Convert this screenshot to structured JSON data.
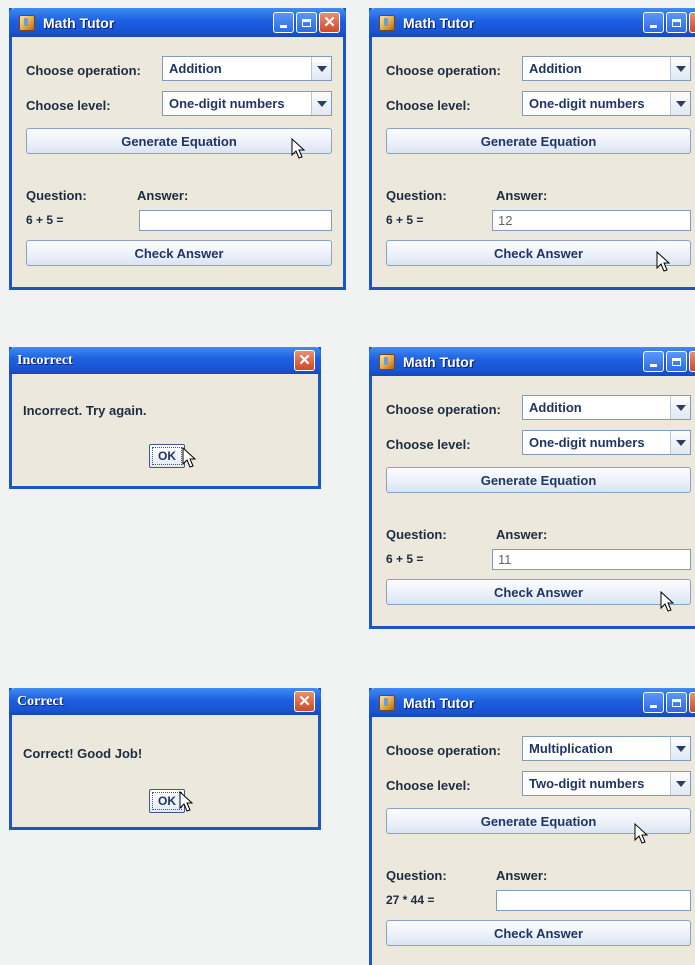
{
  "windows": [
    {
      "title": "Math Tutor",
      "operation_label": "Choose operation:",
      "operation_value": "Addition",
      "level_label": "Choose level:",
      "level_value": "One-digit numbers",
      "generate_label": "Generate Equation",
      "question_label": "Question:",
      "answer_label": "Answer:",
      "question_text": "6 + 5 =",
      "answer_value": "",
      "check_label": "Check Answer"
    },
    {
      "title": "Math Tutor",
      "operation_label": "Choose operation:",
      "operation_value": "Addition",
      "level_label": "Choose level:",
      "level_value": "One-digit numbers",
      "generate_label": "Generate Equation",
      "question_label": "Question:",
      "answer_label": "Answer:",
      "question_text": "6 + 5 =",
      "answer_value": "12",
      "check_label": "Check Answer"
    },
    {
      "title": "Math Tutor",
      "operation_label": "Choose operation:",
      "operation_value": "Addition",
      "level_label": "Choose level:",
      "level_value": "One-digit numbers",
      "generate_label": "Generate Equation",
      "question_label": "Question:",
      "answer_label": "Answer:",
      "question_text": "6 + 5 =",
      "answer_value": "11",
      "check_label": "Check Answer"
    },
    {
      "title": "Math Tutor",
      "operation_label": "Choose operation:",
      "operation_value": "Multiplication",
      "level_label": "Choose level:",
      "level_value": "Two-digit numbers",
      "generate_label": "Generate Equation",
      "question_label": "Question:",
      "answer_label": "Answer:",
      "question_text": "27 * 44 =",
      "answer_value": "",
      "check_label": "Check Answer"
    }
  ],
  "dialogs": [
    {
      "title": "Incorrect",
      "message": "Incorrect. Try again.",
      "ok_label": "OK"
    },
    {
      "title": "Correct",
      "message": "Correct! Good Job!",
      "ok_label": "OK"
    }
  ]
}
